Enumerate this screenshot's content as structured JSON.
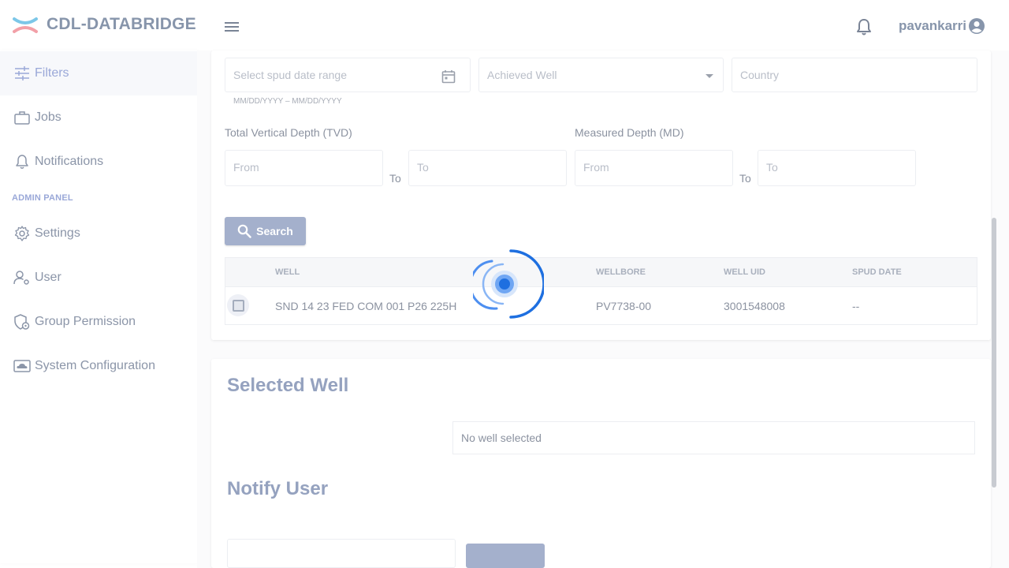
{
  "header": {
    "app_title": "CDL-DATABRIDGE",
    "username": "pavankarri"
  },
  "sidebar": {
    "items": [
      {
        "label": "Filters",
        "icon": "filters-icon"
      },
      {
        "label": "Jobs",
        "icon": "briefcase-icon"
      },
      {
        "label": "Notifications",
        "icon": "bell-icon"
      }
    ],
    "admin_label": "ADMIN PANEL",
    "admin_items": [
      {
        "label": "Settings",
        "icon": "gear-icon"
      },
      {
        "label": "User",
        "icon": "user-gear-icon"
      },
      {
        "label": "Group Permission",
        "icon": "shield-icon"
      },
      {
        "label": "System Configuration",
        "icon": "cloud-icon"
      }
    ]
  },
  "filters": {
    "spud_date_placeholder": "Select spud date range",
    "spud_date_hint": "MM/DD/YYYY – MM/DD/YYYY",
    "achieved_well_placeholder": "Achieved Well",
    "country_placeholder": "Country",
    "tvd_label": "Total Vertical Depth (TVD)",
    "md_label": "Measured Depth (MD)",
    "from_placeholder": "From",
    "to_placeholder": "To",
    "to_label": "To",
    "search_label": "Search"
  },
  "table": {
    "columns": [
      "WELL",
      "WELLBORE",
      "WELL UID",
      "SPUD DATE"
    ],
    "rows": [
      {
        "well": "SND 14 23 FED COM 001 P26 225H",
        "wellbore": "PV7738-00",
        "well_uid": "3001548008",
        "spud_date": "--"
      }
    ]
  },
  "selected_well": {
    "title": "Selected Well",
    "empty_text": "No well selected"
  },
  "notify_user": {
    "title": "Notify User"
  },
  "colors": {
    "accent": "#9aa8d8",
    "button": "#a4b0cc",
    "spinner": "#1e6fe0"
  }
}
